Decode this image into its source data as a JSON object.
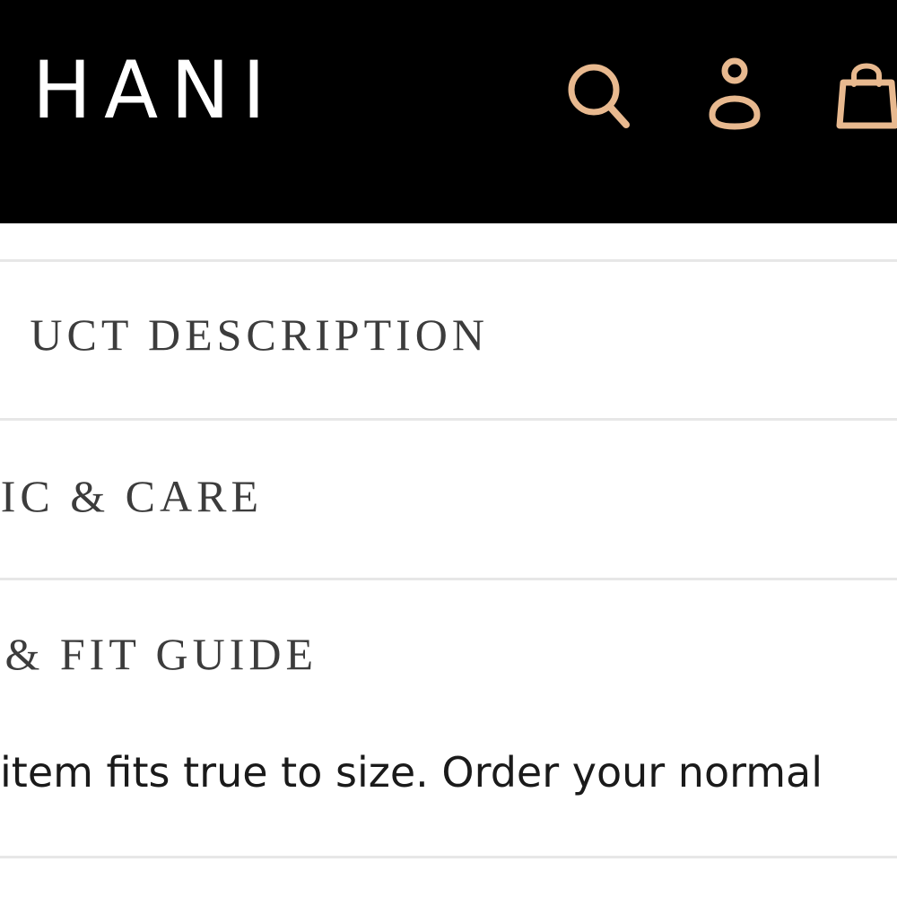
{
  "header": {
    "logo_text": "HANI",
    "icon_color": "#e8b98f",
    "background": "#000000",
    "icons": [
      "search-icon",
      "account-icon",
      "cart-icon"
    ]
  },
  "accordion": {
    "sections": [
      {
        "label": "UCT DESCRIPTION"
      },
      {
        "label": "IC & CARE"
      },
      {
        "label": "& FIT GUIDE"
      }
    ],
    "open_section_text": "item fits true to size. Order your normal"
  }
}
